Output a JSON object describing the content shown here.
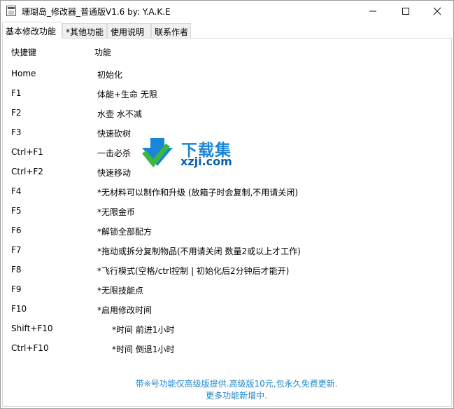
{
  "window": {
    "title": "珊瑚岛_修改器_普通版V1.6 by: Y.A.K.E"
  },
  "tabs": [
    {
      "label": "基本修改功能"
    },
    {
      "label": "*其他功能"
    },
    {
      "label": "使用说明"
    },
    {
      "label": "联系作者"
    }
  ],
  "table": {
    "header_key": "快捷键",
    "header_func": "功能",
    "rows": [
      {
        "key": "Home",
        "func": "初始化"
      },
      {
        "key": "F1",
        "func": "体能+生命 无限"
      },
      {
        "key": "F2",
        "func": "水壶 水不减"
      },
      {
        "key": "F3",
        "func": "快速砍树"
      },
      {
        "key": "Ctrl+F1",
        "func": "一击必杀"
      },
      {
        "key": "Ctrl+F2",
        "func": "快速移动"
      },
      {
        "key": "F4",
        "func": "*无材料可以制作和升级 (放箱子时会复制,不用请关闭)"
      },
      {
        "key": "F5",
        "func": "*无限金币"
      },
      {
        "key": "F6",
        "func": "*解锁全部配方"
      },
      {
        "key": "F7",
        "func": "*拖动或拆分复制物品(不用请关闭 数量2或以上才工作)"
      },
      {
        "key": "F8",
        "func": "*飞行模式(空格/ctrl控制 | 初始化后2分钟后才能开)"
      },
      {
        "key": "F9",
        "func": "*无限技能点"
      },
      {
        "key": "F10",
        "func": "*启用修改时间"
      },
      {
        "key": "Shift+F10",
        "func": "*时间 前进1小时"
      },
      {
        "key": "Ctrl+F10",
        "func": "*时间 倒退1小时"
      }
    ]
  },
  "footer": {
    "line1": "带※号功能仅高级版提供.高级版10元,包永久免费更新.",
    "line2": "更多功能新增中."
  },
  "watermark": {
    "brand": "下载集",
    "url": "xzji.com"
  },
  "colors": {
    "footer_text": "#1f86c9",
    "watermark_blue": "#1a86d8",
    "watermark_green": "#3cb93c"
  },
  "icons": [
    "app-icon",
    "minimize-icon",
    "maximize-icon",
    "close-icon"
  ]
}
